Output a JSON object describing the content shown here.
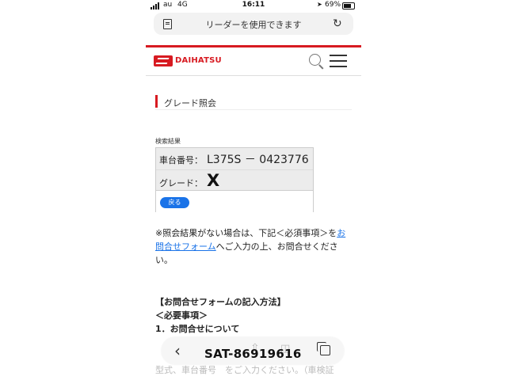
{
  "status_bar": {
    "carrier": "au",
    "network": "4G",
    "time": "16:11",
    "battery": "69%"
  },
  "reader_bar": {
    "label": "リーダーを使用できます",
    "icons": [
      "reader-document-icon",
      "reload-icon"
    ]
  },
  "site": {
    "brand": "DAIHATSU",
    "accent_color": "#d71a21",
    "icons": [
      "search-icon",
      "hamburger-menu-icon"
    ]
  },
  "section_title": "グレード照会",
  "results": {
    "label": "検索結果",
    "rows": [
      {
        "label": "車台番号：",
        "value": "L375S － 0423776"
      },
      {
        "label": "グレード：",
        "value": "X"
      }
    ],
    "back_button": "戻る",
    "button_color": "#1a73e8"
  },
  "note": {
    "text_before": "※照会結果がない場合は、下記＜必須事項＞を",
    "link": "お問合せフォーム",
    "text_after": "へご入力の上、お問合せください。"
  },
  "howto": {
    "title": "【お問合せフォームの記入方法】",
    "subtitle": "＜必要事項＞",
    "item": "1．お問合せについて"
  },
  "faded_text": "型式、車台番号　をご入力ください。（車検証",
  "toolbar": {
    "icons": [
      "back-icon",
      "share-icon",
      "bookmarks-icon",
      "tabs-icon"
    ]
  },
  "watermark": "SAT-86919616"
}
